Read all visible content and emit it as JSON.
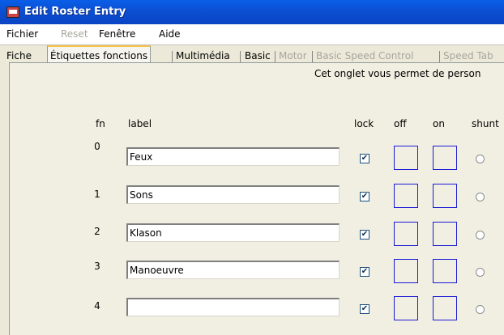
{
  "window": {
    "title": "Edit Roster Entry"
  },
  "menu": [
    "Fichier",
    "Reset",
    "Fenêtre",
    "Aide"
  ],
  "tabs": [
    "Fiche",
    "Étiquettes fonctions",
    "Multimédia",
    "Basic",
    "Motor",
    "Basic Speed Control",
    "Speed Tab"
  ],
  "info_text": "Cet onglet vous permet de person",
  "headers": {
    "fn": "fn",
    "label": "label",
    "lock": "lock",
    "off": "off",
    "on": "on",
    "shunt": "shunt"
  },
  "rows": [
    {
      "fn": "0",
      "label": "Feux",
      "lock": "☑"
    },
    {
      "fn": "1",
      "label": "Sons",
      "lock": "☑"
    },
    {
      "fn": "2",
      "label": "Klason",
      "lock": "☑"
    },
    {
      "fn": "3",
      "label": "Manoeuvre",
      "lock": "☑"
    },
    {
      "fn": "4",
      "label": "",
      "lock": "☑"
    }
  ],
  "colors": {
    "titlebar": "#0a5ee8",
    "selected_tab_accent": "#f7c34c",
    "swatch_border": "#1a1ad6"
  }
}
